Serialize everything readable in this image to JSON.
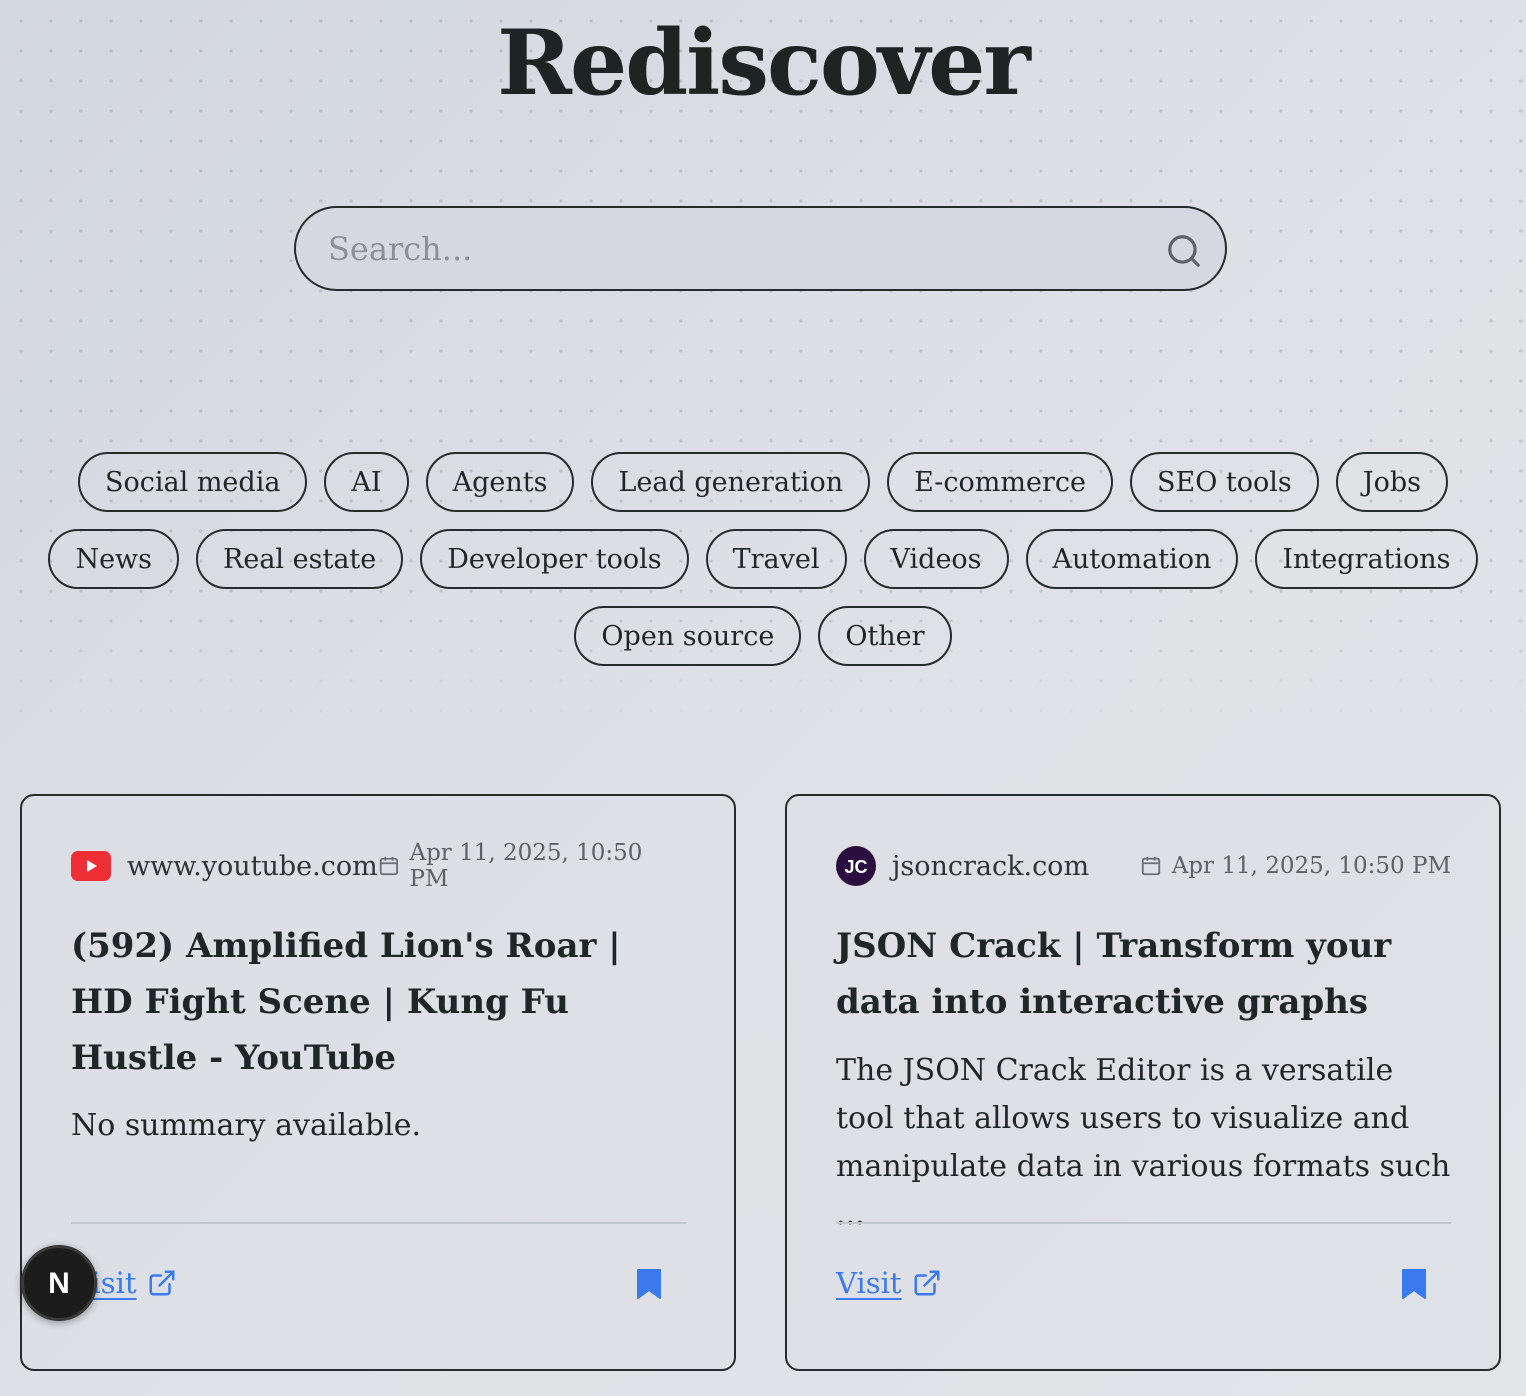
{
  "header": {
    "title": "Rediscover"
  },
  "search": {
    "placeholder": "Search..."
  },
  "tags": [
    "Social media",
    "AI",
    "Agents",
    "Lead generation",
    "E-commerce",
    "SEO tools",
    "Jobs",
    "News",
    "Real estate",
    "Developer tools",
    "Travel",
    "Videos",
    "Automation",
    "Integrations",
    "Open source",
    "Other"
  ],
  "cards": [
    {
      "site": "www.youtube.com",
      "favicon": "youtube-icon",
      "date": "Apr 11, 2025, 10:50 PM",
      "title": "(592) Amplified Lion's Roar | HD Fight Scene | Kung Fu Hustle - YouTube",
      "summary": "No summary available.",
      "visit_label": "Visit"
    },
    {
      "site": "jsoncrack.com",
      "favicon": "jsoncrack-icon",
      "favicon_text": "JC",
      "date": "Apr 11, 2025, 10:50 PM",
      "title": "JSON Crack | Transform your data into interactive graphs",
      "summary": "The JSON Crack Editor is a versatile tool that allows users to visualize and manipulate data in various formats such ...",
      "visit_label": "Visit"
    }
  ],
  "colors": {
    "accent": "#3b79ef",
    "youtube": "#ff0000",
    "jsoncrack": "#2b0d3f",
    "border": "#262b2b"
  },
  "dev_badge": {
    "label": "N",
    "icon": "nextjs-icon"
  }
}
